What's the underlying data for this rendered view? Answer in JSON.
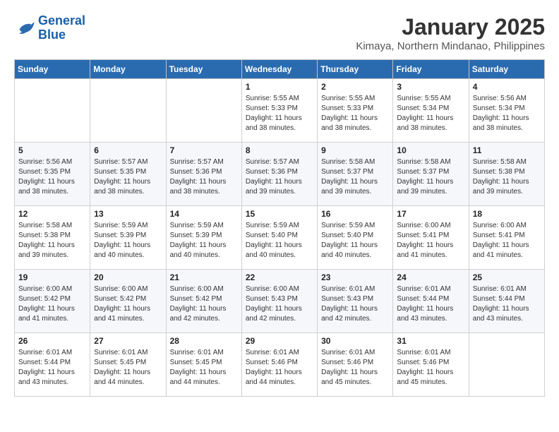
{
  "logo": {
    "line1": "General",
    "line2": "Blue"
  },
  "title": "January 2025",
  "subtitle": "Kimaya, Northern Mindanao, Philippines",
  "days_header": [
    "Sunday",
    "Monday",
    "Tuesday",
    "Wednesday",
    "Thursday",
    "Friday",
    "Saturday"
  ],
  "weeks": [
    [
      {
        "num": "",
        "info": ""
      },
      {
        "num": "",
        "info": ""
      },
      {
        "num": "",
        "info": ""
      },
      {
        "num": "1",
        "info": "Sunrise: 5:55 AM\nSunset: 5:33 PM\nDaylight: 11 hours\nand 38 minutes."
      },
      {
        "num": "2",
        "info": "Sunrise: 5:55 AM\nSunset: 5:33 PM\nDaylight: 11 hours\nand 38 minutes."
      },
      {
        "num": "3",
        "info": "Sunrise: 5:55 AM\nSunset: 5:34 PM\nDaylight: 11 hours\nand 38 minutes."
      },
      {
        "num": "4",
        "info": "Sunrise: 5:56 AM\nSunset: 5:34 PM\nDaylight: 11 hours\nand 38 minutes."
      }
    ],
    [
      {
        "num": "5",
        "info": "Sunrise: 5:56 AM\nSunset: 5:35 PM\nDaylight: 11 hours\nand 38 minutes."
      },
      {
        "num": "6",
        "info": "Sunrise: 5:57 AM\nSunset: 5:35 PM\nDaylight: 11 hours\nand 38 minutes."
      },
      {
        "num": "7",
        "info": "Sunrise: 5:57 AM\nSunset: 5:36 PM\nDaylight: 11 hours\nand 38 minutes."
      },
      {
        "num": "8",
        "info": "Sunrise: 5:57 AM\nSunset: 5:36 PM\nDaylight: 11 hours\nand 39 minutes."
      },
      {
        "num": "9",
        "info": "Sunrise: 5:58 AM\nSunset: 5:37 PM\nDaylight: 11 hours\nand 39 minutes."
      },
      {
        "num": "10",
        "info": "Sunrise: 5:58 AM\nSunset: 5:37 PM\nDaylight: 11 hours\nand 39 minutes."
      },
      {
        "num": "11",
        "info": "Sunrise: 5:58 AM\nSunset: 5:38 PM\nDaylight: 11 hours\nand 39 minutes."
      }
    ],
    [
      {
        "num": "12",
        "info": "Sunrise: 5:58 AM\nSunset: 5:38 PM\nDaylight: 11 hours\nand 39 minutes."
      },
      {
        "num": "13",
        "info": "Sunrise: 5:59 AM\nSunset: 5:39 PM\nDaylight: 11 hours\nand 40 minutes."
      },
      {
        "num": "14",
        "info": "Sunrise: 5:59 AM\nSunset: 5:39 PM\nDaylight: 11 hours\nand 40 minutes."
      },
      {
        "num": "15",
        "info": "Sunrise: 5:59 AM\nSunset: 5:40 PM\nDaylight: 11 hours\nand 40 minutes."
      },
      {
        "num": "16",
        "info": "Sunrise: 5:59 AM\nSunset: 5:40 PM\nDaylight: 11 hours\nand 40 minutes."
      },
      {
        "num": "17",
        "info": "Sunrise: 6:00 AM\nSunset: 5:41 PM\nDaylight: 11 hours\nand 41 minutes."
      },
      {
        "num": "18",
        "info": "Sunrise: 6:00 AM\nSunset: 5:41 PM\nDaylight: 11 hours\nand 41 minutes."
      }
    ],
    [
      {
        "num": "19",
        "info": "Sunrise: 6:00 AM\nSunset: 5:42 PM\nDaylight: 11 hours\nand 41 minutes."
      },
      {
        "num": "20",
        "info": "Sunrise: 6:00 AM\nSunset: 5:42 PM\nDaylight: 11 hours\nand 41 minutes."
      },
      {
        "num": "21",
        "info": "Sunrise: 6:00 AM\nSunset: 5:42 PM\nDaylight: 11 hours\nand 42 minutes."
      },
      {
        "num": "22",
        "info": "Sunrise: 6:00 AM\nSunset: 5:43 PM\nDaylight: 11 hours\nand 42 minutes."
      },
      {
        "num": "23",
        "info": "Sunrise: 6:01 AM\nSunset: 5:43 PM\nDaylight: 11 hours\nand 42 minutes."
      },
      {
        "num": "24",
        "info": "Sunrise: 6:01 AM\nSunset: 5:44 PM\nDaylight: 11 hours\nand 43 minutes."
      },
      {
        "num": "25",
        "info": "Sunrise: 6:01 AM\nSunset: 5:44 PM\nDaylight: 11 hours\nand 43 minutes."
      }
    ],
    [
      {
        "num": "26",
        "info": "Sunrise: 6:01 AM\nSunset: 5:44 PM\nDaylight: 11 hours\nand 43 minutes."
      },
      {
        "num": "27",
        "info": "Sunrise: 6:01 AM\nSunset: 5:45 PM\nDaylight: 11 hours\nand 44 minutes."
      },
      {
        "num": "28",
        "info": "Sunrise: 6:01 AM\nSunset: 5:45 PM\nDaylight: 11 hours\nand 44 minutes."
      },
      {
        "num": "29",
        "info": "Sunrise: 6:01 AM\nSunset: 5:46 PM\nDaylight: 11 hours\nand 44 minutes."
      },
      {
        "num": "30",
        "info": "Sunrise: 6:01 AM\nSunset: 5:46 PM\nDaylight: 11 hours\nand 45 minutes."
      },
      {
        "num": "31",
        "info": "Sunrise: 6:01 AM\nSunset: 5:46 PM\nDaylight: 11 hours\nand 45 minutes."
      },
      {
        "num": "",
        "info": ""
      }
    ]
  ]
}
